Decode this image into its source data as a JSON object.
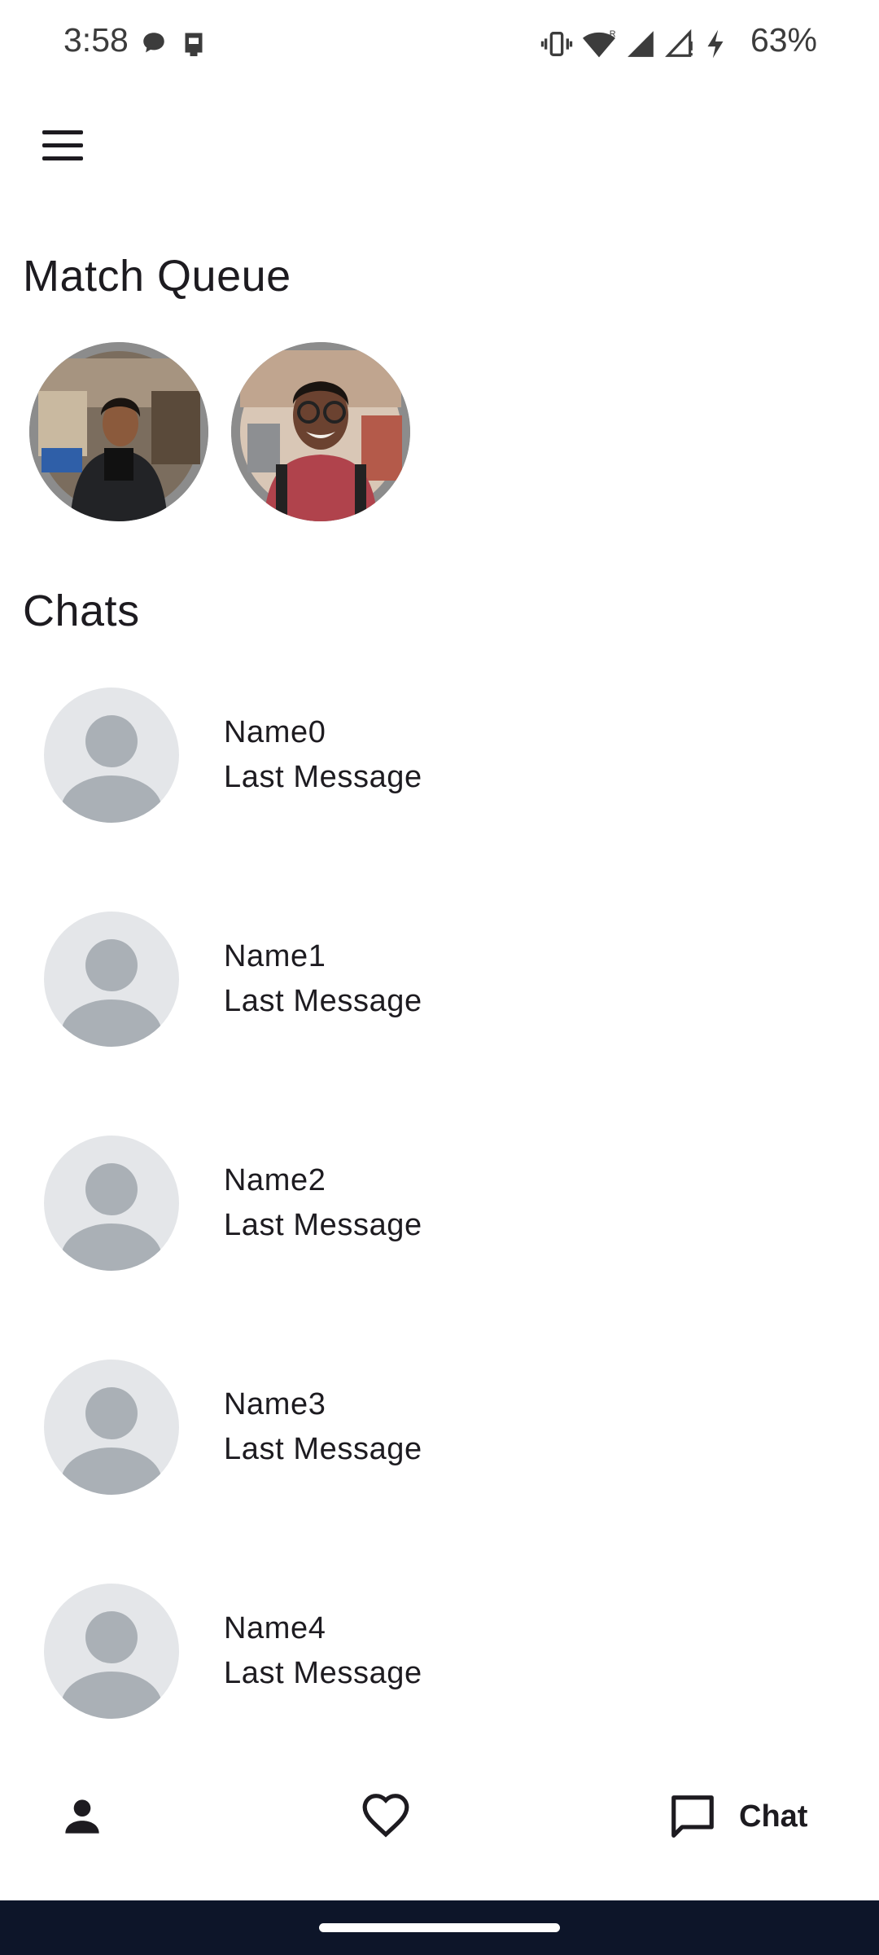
{
  "status_bar": {
    "time": "3:58",
    "battery": "63%",
    "icons": [
      "chat-bubble-icon",
      "sim-card-icon",
      "vibrate-icon",
      "wifi-icon",
      "signal-icon",
      "signal-no-service-icon",
      "charging-icon"
    ]
  },
  "header": {
    "menu_icon": "hamburger-menu-icon"
  },
  "match_queue": {
    "title": "Match Queue",
    "items": [
      {
        "photo": "profile-photo-1"
      },
      {
        "photo": "profile-photo-2"
      }
    ]
  },
  "chats": {
    "title": "Chats",
    "items": [
      {
        "name": "Name0",
        "last_message": "Last Message"
      },
      {
        "name": "Name1",
        "last_message": "Last Message"
      },
      {
        "name": "Name2",
        "last_message": "Last Message"
      },
      {
        "name": "Name3",
        "last_message": "Last Message"
      },
      {
        "name": "Name4",
        "last_message": "Last Message"
      }
    ]
  },
  "bottom_nav": {
    "profile_icon": "person-icon",
    "likes_icon": "heart-icon",
    "chat_icon": "chat-icon",
    "chat_label": "Chat"
  },
  "colors": {
    "text": "#1d1b20",
    "avatar_bg": "#e4e6e9",
    "avatar_fg": "#aab0b6",
    "system_nav": "#0d1529"
  }
}
